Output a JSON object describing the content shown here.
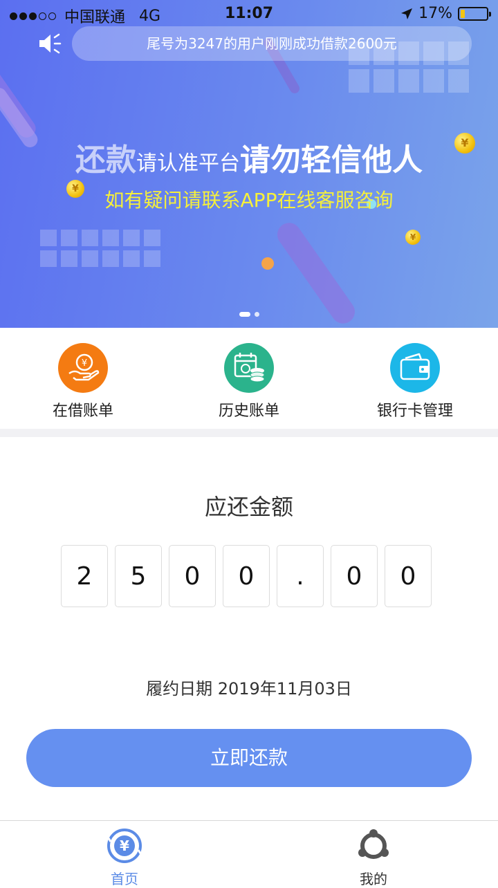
{
  "status_bar": {
    "carrier": "中国联通",
    "network": "4G",
    "time": "11:07",
    "battery": "17%",
    "battery_level": 0.17
  },
  "banner": {
    "ticker": "尾号为3247的用户刚刚成功借款2600元",
    "headline_part1": "还款",
    "headline_part2": "请认准平台",
    "headline_part3": "请勿轻信他人",
    "subline": "如有疑问请联系APP在线客服咨询",
    "coin_symbol": "¥",
    "pages": 2,
    "active_page": 1
  },
  "quick_menu": [
    {
      "label": "在借账单",
      "icon": "hand-coin-icon",
      "color": "#f47b12"
    },
    {
      "label": "历史账单",
      "icon": "calendar-coins-icon",
      "color": "#2bb38c"
    },
    {
      "label": "银行卡管理",
      "icon": "wallet-icon",
      "color": "#1cb7e8"
    }
  ],
  "repayment": {
    "title": "应还金额",
    "amount_chars": [
      "2",
      "5",
      "0",
      "0",
      ".",
      "0",
      "0"
    ],
    "due_label": "履约日期",
    "due_date": "2019年11月03日",
    "button_label": "立即还款",
    "accent": "#6590f0"
  },
  "tab_bar": [
    {
      "label": "首页",
      "icon": "yuan-refresh-icon",
      "active": true,
      "color": "#5b8be6"
    },
    {
      "label": "我的",
      "icon": "people-network-icon",
      "active": false,
      "color": "#555555"
    }
  ]
}
